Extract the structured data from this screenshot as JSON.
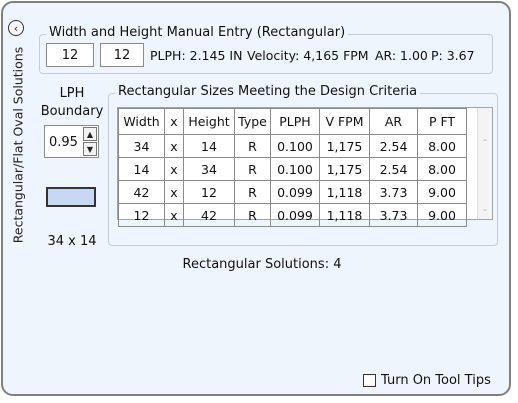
{
  "side_tab": {
    "label": "Rectangular/Flat Oval Solutions",
    "back_icon": "chevron-left-circle-icon"
  },
  "manual_entry": {
    "title": "Width and Height Manual Entry (Rectangular)",
    "width_value": "12",
    "height_value": "12",
    "plph": "PLPH: 2.145 IN",
    "velocity": "Velocity: 4,165 FPM",
    "ar": "AR: 1.00",
    "p": "P: 3.67"
  },
  "lph": {
    "title_line1": "LPH",
    "title_line2": "Boundary",
    "value": "0.95",
    "up_icon": "spin-up-icon",
    "down_icon": "spin-down-icon"
  },
  "preview": {
    "label": "34 x 14",
    "fill_color": "#c7d9f2"
  },
  "sizes": {
    "title": "Rectangular Sizes Meeting the Design Criteria",
    "columns": [
      "Width",
      "x",
      "Height",
      "Type",
      "PLPH",
      "V FPM",
      "AR",
      "P FT"
    ],
    "rows": [
      [
        "34",
        "x",
        "14",
        "R",
        "0.100",
        "1,175",
        "2.54",
        "8.00"
      ],
      [
        "14",
        "x",
        "34",
        "R",
        "0.100",
        "1,175",
        "2.54",
        "8.00"
      ],
      [
        "42",
        "x",
        "12",
        "R",
        "0.099",
        "1,118",
        "3.73",
        "9.00"
      ],
      [
        "12",
        "x",
        "42",
        "R",
        "0.099",
        "1,118",
        "3.73",
        "9.00"
      ]
    ]
  },
  "solutions_text": "Rectangular Solutions: 4",
  "tooltips": {
    "label": "Turn On Tool Tips",
    "checked": false
  }
}
